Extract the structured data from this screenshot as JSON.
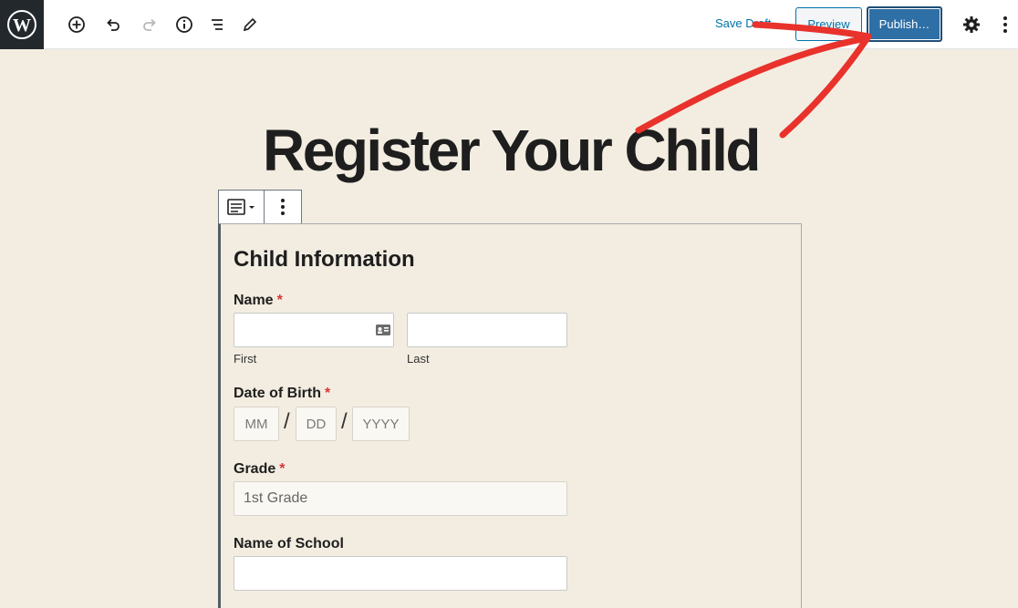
{
  "toolbar": {
    "save_draft": "Save Draft",
    "preview": "Preview",
    "publish": "Publish…",
    "icons": [
      "wordpress-logo",
      "add-block-icon",
      "undo-icon",
      "redo-icon",
      "info-icon",
      "list-view-icon",
      "edit-tools-icon",
      "gear-icon",
      "more-vertical-icon"
    ]
  },
  "post": {
    "title": "Register Your Child"
  },
  "form": {
    "heading": "Child Information",
    "name": {
      "label": "Name",
      "required": "*",
      "first_sublabel": "First",
      "last_sublabel": "Last"
    },
    "dob": {
      "label": "Date of Birth",
      "required": "*",
      "month_placeholder": "MM",
      "day_placeholder": "DD",
      "year_placeholder": "YYYY",
      "separator": "/"
    },
    "grade": {
      "label": "Grade",
      "required": "*",
      "value": "1st Grade"
    },
    "school": {
      "label": "Name of School"
    }
  },
  "colors": {
    "accent": "#0073aa",
    "publish_bg": "#2e6fa6",
    "canvas_bg": "#f3ede1",
    "required": "#d63638",
    "annotation_arrow": "#e8322b"
  }
}
